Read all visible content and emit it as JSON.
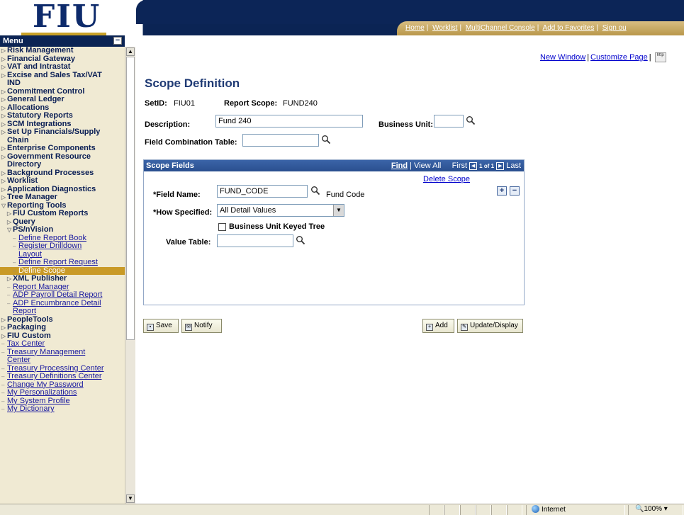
{
  "header": {
    "logo_text": "FIU",
    "links": [
      "Home",
      "Worklist",
      "MultiChannel Console",
      "Add to Favorites",
      "Sign ou"
    ]
  },
  "sidebar": {
    "title": "Menu",
    "items": [
      {
        "label": "Risk Management",
        "type": "folder"
      },
      {
        "label": "Financial Gateway",
        "type": "folder"
      },
      {
        "label": "VAT and Intrastat",
        "type": "folder"
      },
      {
        "label": "Excise and Sales Tax/VAT",
        "type": "folder"
      },
      {
        "label": "IND",
        "type": "cont"
      },
      {
        "label": "Commitment Control",
        "type": "folder"
      },
      {
        "label": "General Ledger",
        "type": "folder"
      },
      {
        "label": "Allocations",
        "type": "folder"
      },
      {
        "label": "Statutory Reports",
        "type": "folder"
      },
      {
        "label": "SCM Integrations",
        "type": "folder"
      },
      {
        "label": "Set Up Financials/Supply",
        "type": "folder"
      },
      {
        "label": "Chain",
        "type": "cont"
      },
      {
        "label": "Enterprise Components",
        "type": "folder"
      },
      {
        "label": "Government Resource",
        "type": "folder"
      },
      {
        "label": "Directory",
        "type": "cont"
      },
      {
        "label": "Background Processes",
        "type": "folder"
      },
      {
        "label": "Worklist",
        "type": "folder"
      },
      {
        "label": "Application Diagnostics",
        "type": "folder"
      },
      {
        "label": "Tree Manager",
        "type": "folder"
      },
      {
        "label": "Reporting Tools",
        "type": "open"
      },
      {
        "label": "FIU Custom Reports",
        "type": "folder",
        "indent": 1
      },
      {
        "label": "Query",
        "type": "folder",
        "indent": 1
      },
      {
        "label": "PS/nVision",
        "type": "open",
        "indent": 1
      },
      {
        "label": "Define Report Book",
        "type": "link",
        "indent": 2
      },
      {
        "label": "Register Drilldown",
        "type": "link",
        "indent": 2
      },
      {
        "label": "Layout",
        "type": "linkcont",
        "indent": 2
      },
      {
        "label": "Define Report Request",
        "type": "link",
        "indent": 2
      },
      {
        "label": "Define Scope",
        "type": "selected",
        "indent": 2
      },
      {
        "label": "XML Publisher",
        "type": "folder",
        "indent": 1
      },
      {
        "label": "Report Manager",
        "type": "link",
        "indent": 1
      },
      {
        "label": "ADP Payroll Detail Report",
        "type": "link",
        "indent": 1
      },
      {
        "label": "ADP Encumbrance Detail",
        "type": "link",
        "indent": 1
      },
      {
        "label": "Report",
        "type": "linkcont",
        "indent": 1
      },
      {
        "label": "PeopleTools",
        "type": "folder"
      },
      {
        "label": "Packaging",
        "type": "folder"
      },
      {
        "label": "FIU Custom",
        "type": "folder"
      },
      {
        "label": "Tax Center",
        "type": "link"
      },
      {
        "label": "Treasury Management",
        "type": "link"
      },
      {
        "label": "Center",
        "type": "linkcont"
      },
      {
        "label": "Treasury Processing Center",
        "type": "link"
      },
      {
        "label": "Treasury Definitions Center",
        "type": "link"
      },
      {
        "label": "Change My Password",
        "type": "link"
      },
      {
        "label": "My Personalizations",
        "type": "link"
      },
      {
        "label": "My System Profile",
        "type": "link"
      },
      {
        "label": "My Dictionary",
        "type": "link"
      }
    ]
  },
  "page_links": {
    "new_window": "New Window",
    "customize_page": "Customize Page",
    "http_icon": "http"
  },
  "page": {
    "title": "Scope Definition",
    "setid_label": "SetID:",
    "setid_value": "FIU01",
    "report_scope_label": "Report Scope:",
    "report_scope_value": "FUND240",
    "description_label": "Description:",
    "description_value": "Fund 240",
    "business_unit_label": "Business Unit:",
    "business_unit_value": "",
    "field_combination_label": "Field Combination Table:",
    "field_combination_value": ""
  },
  "scope_fields": {
    "header": "Scope Fields",
    "find": "Find",
    "view_all": "View All",
    "first": "First",
    "page_info": "1 of 1",
    "last": "Last",
    "delete_scope": "Delete Scope",
    "field_name_label": "*Field Name:",
    "field_name_value": "FUND_CODE",
    "field_name_desc": "Fund Code",
    "how_specified_label": "*How Specified:",
    "how_specified_value": "All Detail Values",
    "bu_keyed_tree_label": "Business Unit Keyed Tree",
    "value_table_label": "Value Table:",
    "value_table_value": ""
  },
  "buttons": {
    "save": "Save",
    "notify": "Notify",
    "add": "Add",
    "update_display": "Update/Display"
  },
  "status_bar": {
    "zone": "Internet",
    "zoom": "100%"
  },
  "colors": {
    "navy": "#0b2454",
    "gold": "#c99a27",
    "sidebar_bg": "#f0ead3",
    "grid_header": "#2a4f8f",
    "title_blue": "#1f3a74"
  }
}
